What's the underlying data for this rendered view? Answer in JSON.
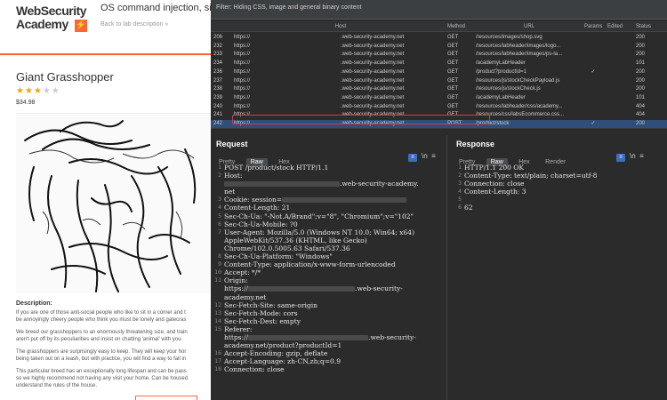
{
  "shop": {
    "logo_line1": "WebSecurity",
    "logo_line2": "Academy",
    "lab_title": "OS command injection, sim",
    "back_link": "Back to lab description",
    "product_title": "Giant Grasshopper",
    "rating": {
      "value": 3,
      "max": 5
    },
    "price": "$34.98",
    "description_heading": "Description:",
    "paragraphs": [
      [
        "If you are one of those anti-social people who like to sit in a corner and t",
        "be annoyingly cheery people who think you must be lonely and gatecras"
      ],
      [
        "We breed our grasshoppers to an enormously threatening size, and train",
        "aren't put off by its peculiarities and insist on chatting 'animal' with you."
      ],
      [
        "The grasshoppers are surprisingly easy to keep. They will keep your hor",
        "being taken out on a leash, but with practice, you will find a way to fall in"
      ],
      [
        "This particular breed has an exceptionally long lifespan and can be pass",
        "so we highly recommend not having any visit your home. Can be housed",
        "understand the rules of the house."
      ]
    ]
  },
  "burp": {
    "filter_text": "Filter: Hiding CSS, image and general binary content",
    "columns": {
      "host": "Host",
      "method": "Method",
      "url": "URL",
      "params": "Params",
      "edited": "Edited",
      "status": "Status"
    },
    "history": [
      {
        "num": "206",
        "host": "https://",
        "domain": ".web-security-academy.net",
        "method": "GET",
        "url": "/resources/images/shop.svg",
        "params": "",
        "status": "200"
      },
      {
        "num": "232",
        "host": "https://",
        "domain": ".web-security-academy.net",
        "method": "GET",
        "url": "/resources/labheader/images/logo...",
        "params": "",
        "status": "200"
      },
      {
        "num": "233",
        "host": "https://",
        "domain": ".web-security-academy.net",
        "method": "GET",
        "url": "/resources/labheader/images/ps-la...",
        "params": "",
        "status": "200"
      },
      {
        "num": "234",
        "host": "https://",
        "domain": ".web-security-academy.net",
        "method": "GET",
        "url": "/academyLabHeader",
        "params": "",
        "status": "101"
      },
      {
        "num": "236",
        "host": "https://",
        "domain": ".web-security-academy.net",
        "method": "GET",
        "url": "/product?productId=1",
        "params": "✓",
        "status": "200"
      },
      {
        "num": "237",
        "host": "https://",
        "domain": ".web-security-academy.net",
        "method": "GET",
        "url": "/resources/js/stockCheckPayload.js",
        "params": "",
        "status": "200"
      },
      {
        "num": "238",
        "host": "https://",
        "domain": ".web-security-academy.net",
        "method": "GET",
        "url": "/resources/js/stockCheck.js",
        "params": "",
        "status": "200"
      },
      {
        "num": "239",
        "host": "https://",
        "domain": ".web-security-academy.net",
        "method": "GET",
        "url": "/academyLabHeader",
        "params": "",
        "status": "101"
      },
      {
        "num": "240",
        "host": "https://",
        "domain": ".web-security-academy.net",
        "method": "GET",
        "url": "/resources/labheader/css/academy...",
        "params": "",
        "status": "404"
      },
      {
        "num": "241",
        "host": "https://",
        "domain": ".web-security-academy.net",
        "method": "GET",
        "url": "/resources/css/labsEcommerce.css...",
        "params": "",
        "status": "404"
      },
      {
        "num": "242",
        "host": "https://",
        "domain": ".web-security-academy.net",
        "method": "POST",
        "url": "/product/stock",
        "params": "✓",
        "status": "200"
      }
    ],
    "request": {
      "title": "Request",
      "tabs": [
        "Pretty",
        "Raw",
        "Hex"
      ],
      "active_tab": "Raw",
      "lines": [
        {
          "no": "1",
          "text": "POST /product/stock HTTP/1.1"
        },
        {
          "no": "2",
          "text": "Host:"
        },
        {
          "no": "",
          "text": ".web-security-academy."
        },
        {
          "no": "",
          "text": "net"
        },
        {
          "no": "3",
          "text": "Cookie: session="
        },
        {
          "no": "4",
          "text": "Content-Length: 21"
        },
        {
          "no": "5",
          "text": "Sec-Ch-Ua: \"-Not.A/Brand\";v=\"8\", \"Chromium\";v=\"102\""
        },
        {
          "no": "6",
          "text": "Sec-Ch-Ua-Mobile: ?0"
        },
        {
          "no": "7",
          "text": "User-Agent: Mozilla/5.0 (Windows NT 10.0; Win64; x64)"
        },
        {
          "no": "",
          "text": "AppleWebKit/537.36 (KHTML, like Gecko)"
        },
        {
          "no": "",
          "text": "Chrome/102.0.5005.63 Safari/537.36"
        },
        {
          "no": "8",
          "text": "Sec-Ch-Ua-Platform: \"Windows\""
        },
        {
          "no": "9",
          "text": "Content-Type: application/x-www-form-urlencoded"
        },
        {
          "no": "10",
          "text": "Accept: */*"
        },
        {
          "no": "11",
          "text": "Origin:"
        },
        {
          "no": "",
          "text": "https://"
        },
        {
          "no": "",
          "text": "academy.net"
        },
        {
          "no": "12",
          "text": "Sec-Fetch-Site: same-origin"
        },
        {
          "no": "13",
          "text": "Sec-Fetch-Mode: cors"
        },
        {
          "no": "14",
          "text": "Sec-Fetch-Dest: empty"
        },
        {
          "no": "15",
          "text": "Referer:"
        },
        {
          "no": "",
          "text": "https://"
        },
        {
          "no": "",
          "text": "academy.net/product?productId=1"
        },
        {
          "no": "16",
          "text": "Accept-Encoding: gzip, deflate"
        },
        {
          "no": "17",
          "text": "Accept-Language: zh-CN,zh;q=0.9"
        },
        {
          "no": "18",
          "text": "Connection: close"
        }
      ],
      "line_web_security_1": ".web-security-",
      "line_web_security_2": ".web-security-"
    },
    "response": {
      "title": "Response",
      "tabs": [
        "Pretty",
        "Raw",
        "Hex",
        "Render"
      ],
      "active_tab": "Raw",
      "lines": [
        {
          "no": "1",
          "text": "HTTP/1.1 200 OK"
        },
        {
          "no": "2",
          "text": "Content-Type: text/plain; charset=utf-8"
        },
        {
          "no": "3",
          "text": "Connection: close"
        },
        {
          "no": "4",
          "text": "Content-Length: 3"
        },
        {
          "no": "5",
          "text": ""
        },
        {
          "no": "6",
          "text": "62"
        }
      ]
    },
    "icon_newline": "\\n",
    "icon_menu": "≡",
    "colors": {
      "accent": "#ff6633",
      "selected_row": "#2f4f7a",
      "highlight": "#d9374b"
    }
  }
}
